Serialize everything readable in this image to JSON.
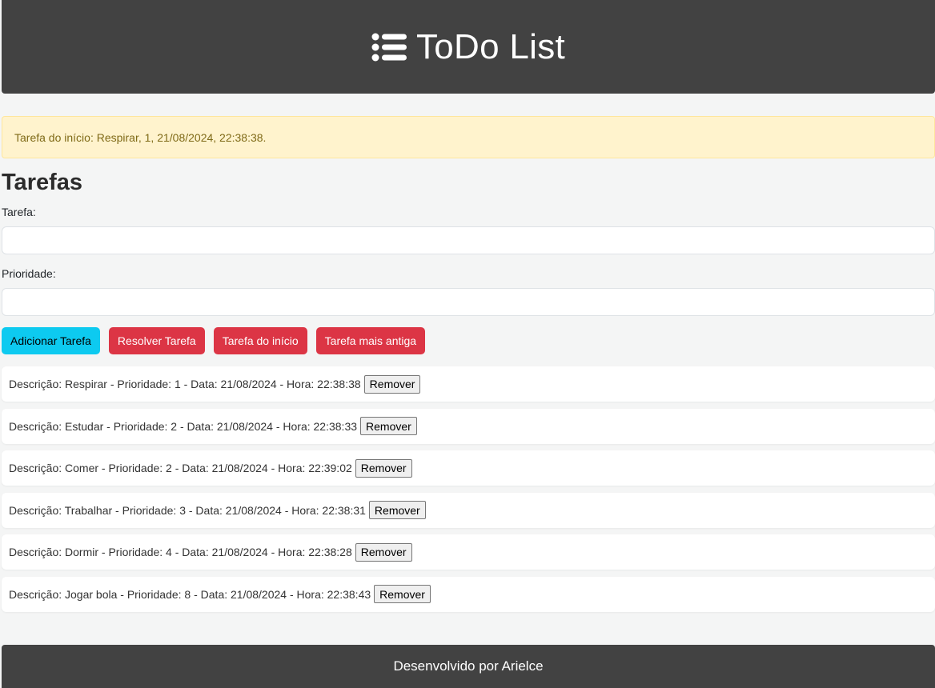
{
  "header": {
    "icon": "list-icon",
    "title": "ToDo List"
  },
  "alert": {
    "text": "Tarefa do início: Respirar, 1, 21/08/2024, 22:38:38."
  },
  "section": {
    "title": "Tarefas"
  },
  "form": {
    "task_label": "Tarefa:",
    "task_value": "",
    "priority_label": "Prioridade:",
    "priority_value": ""
  },
  "buttons": {
    "add": "Adicionar Tarefa",
    "resolve": "Resolver Tarefa",
    "first": "Tarefa do início",
    "oldest": "Tarefa mais antiga"
  },
  "tasks": [
    {
      "text": "Descrição: Respirar - Prioridade: 1 - Data: 21/08/2024 - Hora: 22:38:38",
      "remove": "Remover"
    },
    {
      "text": "Descrição: Estudar - Prioridade: 2 - Data: 21/08/2024 - Hora: 22:38:33",
      "remove": "Remover"
    },
    {
      "text": "Descrição: Comer - Prioridade: 2 - Data: 21/08/2024 - Hora: 22:39:02",
      "remove": "Remover"
    },
    {
      "text": "Descrição: Trabalhar - Prioridade: 3 - Data: 21/08/2024 - Hora: 22:38:31",
      "remove": "Remover"
    },
    {
      "text": "Descrição: Dormir - Prioridade: 4 - Data: 21/08/2024 - Hora: 22:38:28",
      "remove": "Remover"
    },
    {
      "text": "Descrição: Jogar bola - Prioridade: 8 - Data: 21/08/2024 - Hora: 22:38:43",
      "remove": "Remover"
    }
  ],
  "footer": {
    "text": "Desenvolvido por Arielce"
  },
  "colors": {
    "header_bg": "#424242",
    "alert_bg": "#fff3cd",
    "info": "#0dcaf0",
    "danger": "#dc3545"
  }
}
